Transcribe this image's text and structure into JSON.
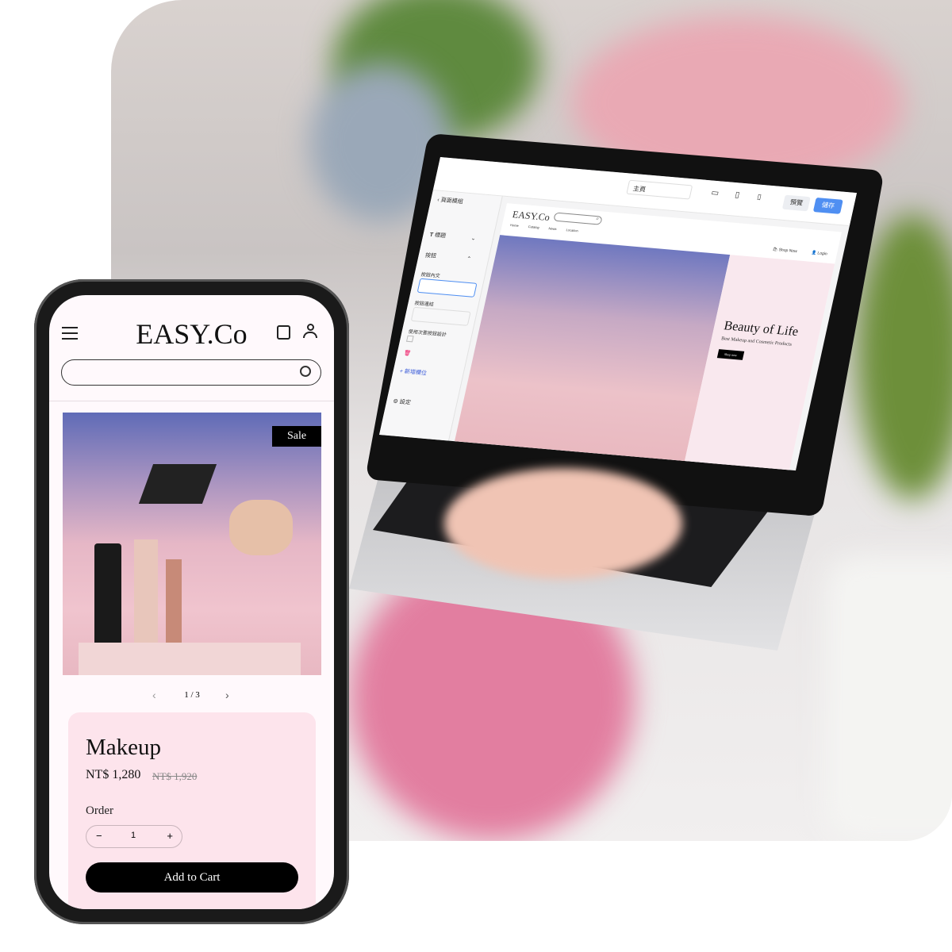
{
  "laptop": {
    "topbar": {
      "page_select": "主頁",
      "preview_button": "預覽",
      "save_button": "儲存",
      "accent": "#4f8ff2"
    },
    "sidebar": {
      "back_label": "頁面模組",
      "items": [
        {
          "label": "標題"
        },
        {
          "label": "按鈕"
        }
      ],
      "fields": {
        "button_text": "按鈕內文",
        "button_link": "按鈕連結",
        "secondary_style": "使用次要按鈕設計"
      },
      "add_field": "新增欄位",
      "settings": "設定"
    },
    "site": {
      "logo": "EASY.Co",
      "nav": [
        "Home",
        "Catalog",
        "News",
        "Location"
      ],
      "shop_now": "Shop Now",
      "login": "Login",
      "hero_title": "Beauty of Life",
      "hero_subtitle": "Best Makeup and Cosmetic Products",
      "hero_button": "Shop now"
    }
  },
  "phone": {
    "logo": "EASY.Co",
    "search": {
      "value": "",
      "placeholder": ""
    },
    "badge": "Sale",
    "pager": "1 / 3",
    "product": {
      "title": "Makeup",
      "price": "NT$ 1,280",
      "original_price": "NT$ 1,920",
      "order_label": "Order",
      "quantity": "1",
      "add_to_cart": "Add to Cart"
    },
    "card_color": "#fde4ec"
  }
}
